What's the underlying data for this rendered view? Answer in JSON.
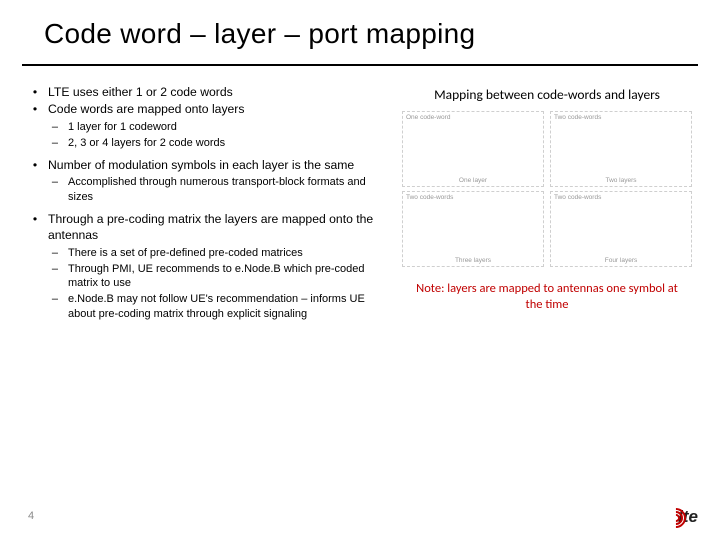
{
  "title": "Code word – layer – port mapping",
  "page_number": "4",
  "logo": {
    "text": "lte"
  },
  "left": {
    "b1": "LTE uses either 1 or 2 code words",
    "b2": "Code words are mapped onto layers",
    "b2s1": "1 layer  for 1 codeword",
    "b2s2": "2, 3 or 4 layers for 2 code words",
    "b3": "Number of modulation symbols in each layer is the same",
    "b3s1": "Accomplished through numerous transport-block formats and sizes",
    "b4": "Through a pre-coding matrix the layers are mapped onto the antennas",
    "b4s1": "There is a set of pre-defined pre-coded matrices",
    "b4s2": "Through PMI, UE recommends to e.Node.B which pre-coded matrix to use",
    "b4s3": "e.Node.B may not follow UE's recommendation – informs UE about pre-coding matrix through explicit signaling"
  },
  "right": {
    "heading": "Mapping between code-words and layers",
    "diagrams": [
      {
        "top": "One code-word",
        "bottom": "One layer"
      },
      {
        "top": "Two code-words",
        "bottom": "Two layers"
      },
      {
        "top": "Two code-words",
        "bottom": "Three layers"
      },
      {
        "top": "Two code-words",
        "bottom": "Four layers"
      }
    ],
    "note": "Note: layers are mapped to antennas one symbol at the time"
  }
}
